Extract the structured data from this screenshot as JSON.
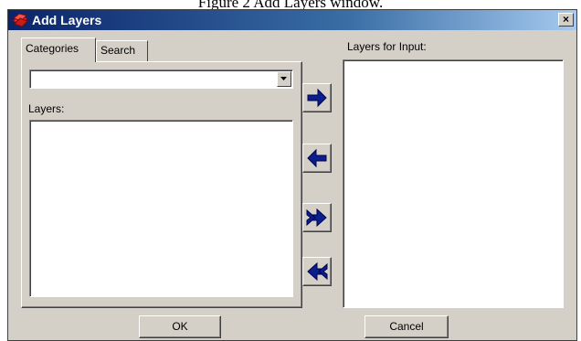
{
  "caption": "Figure 2 Add Layers window.",
  "window": {
    "title": "Add Layers",
    "close_glyph": "×"
  },
  "tabs": [
    {
      "label": "Categories",
      "active": true
    },
    {
      "label": "Search",
      "active": false
    }
  ],
  "category_select": {
    "selected": ""
  },
  "labels": {
    "layers": "Layers:",
    "layers_for_input": "Layers for Input:"
  },
  "transfer_buttons": [
    {
      "icon": "arrow-right-icon",
      "action": "add selected"
    },
    {
      "icon": "arrow-left-icon",
      "action": "remove selected"
    },
    {
      "icon": "double-arrow-right-icon",
      "action": "add all"
    },
    {
      "icon": "double-arrow-left-icon",
      "action": "remove all"
    }
  ],
  "buttons": {
    "ok": "OK",
    "cancel": "Cancel"
  },
  "colors": {
    "titlebar_start": "#0a246a",
    "titlebar_end": "#a6caf0",
    "face": "#d4d0c8",
    "arrow": "#0a1e8c"
  }
}
